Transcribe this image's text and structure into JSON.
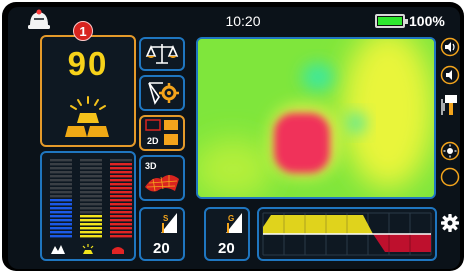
{
  "status_bar": {
    "time": "10:20",
    "battery_percent_label": "100%",
    "battery_level": 1.0
  },
  "depth_panel": {
    "badge_number": "1",
    "depth_value": "90",
    "icon": "gold-bars-icon"
  },
  "tools": {
    "balance": {
      "icon": "balance-scale-icon"
    },
    "tune": {
      "icon": "ground-balance-gear-icon"
    },
    "view_mode": {
      "icon": "2d-view-icon",
      "label": "2D"
    },
    "view_3d": {
      "icon": "3d-surface-icon",
      "label": "3D"
    },
    "sensitivity": {
      "label": "S",
      "value": "20"
    },
    "gain": {
      "label": "G",
      "value": "20"
    }
  },
  "scan_map": {
    "colors": {
      "background": "#7fe63c",
      "warm": "#e9f53a",
      "cool": "#3de89b",
      "target": "#f0305a"
    }
  },
  "signal_bars": {
    "columns": [
      {
        "color": "#1c5ae8",
        "level": 0.5
      },
      {
        "color": "#f2e41c",
        "level": 0.3
      },
      {
        "color": "#e12424",
        "level": 0.95
      }
    ],
    "modes": [
      "mineral-icon",
      "metal-icon",
      "cavity-icon"
    ]
  },
  "signal_gauge": {
    "colors": {
      "positive": "#f2e41c",
      "negative": "#c8102e"
    }
  },
  "side_buttons": [
    {
      "icon": "volume-up-icon"
    },
    {
      "icon": "volume-down-icon"
    },
    {
      "icon": "antenna-icon"
    },
    {
      "icon": "brightness-up-icon"
    },
    {
      "icon": "brightness-down-icon"
    },
    {
      "icon": "settings-gear-icon"
    }
  ]
}
